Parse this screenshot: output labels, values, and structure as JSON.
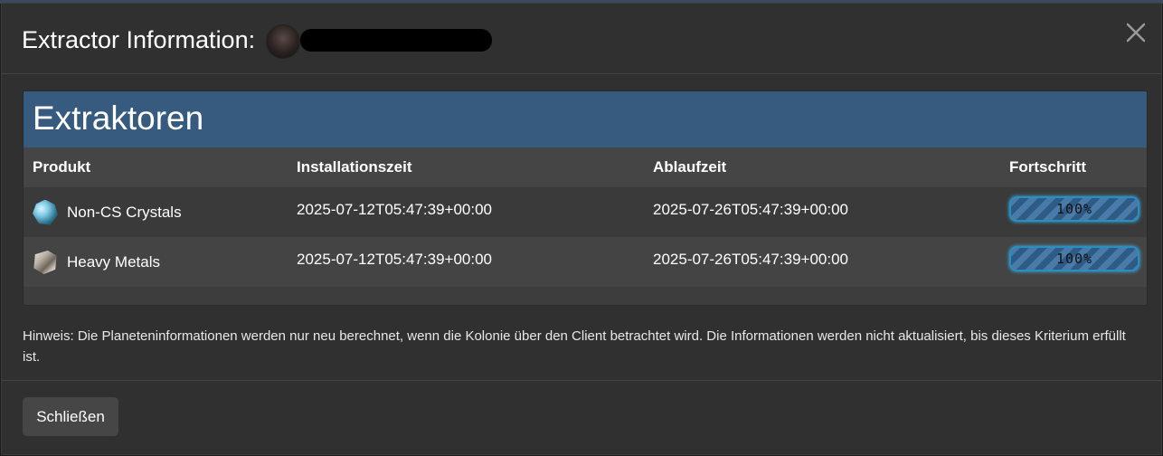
{
  "modal": {
    "title": "Extractor Information:",
    "close_footer_label": "Schließen"
  },
  "panel": {
    "title": "Extraktoren",
    "columns": [
      "Produkt",
      "Installationszeit",
      "Ablaufzeit",
      "Fortschritt"
    ],
    "rows": [
      {
        "product": "Non-CS Crystals",
        "icon": "crystal-icon",
        "install_time": "2025-07-12T05:47:39+00:00",
        "expiry_time": "2025-07-26T05:47:39+00:00",
        "progress_label": "100%",
        "progress_value": 100
      },
      {
        "product": "Heavy Metals",
        "icon": "metal-icon",
        "install_time": "2025-07-12T05:47:39+00:00",
        "expiry_time": "2025-07-26T05:47:39+00:00",
        "progress_label": "100%",
        "progress_value": 100
      }
    ]
  },
  "note": "Hinweis: Die Planeteninformationen werden nur neu berechnet, wenn die Kolonie über den Client betrachtet wird. Die Informationen werden nicht aktualisiert, bis dieses Kriterium erfüllt ist.",
  "colors": {
    "panel_heading": "#375a7f",
    "modal_bg": "#303030",
    "progress_border": "#2a8fbf"
  }
}
